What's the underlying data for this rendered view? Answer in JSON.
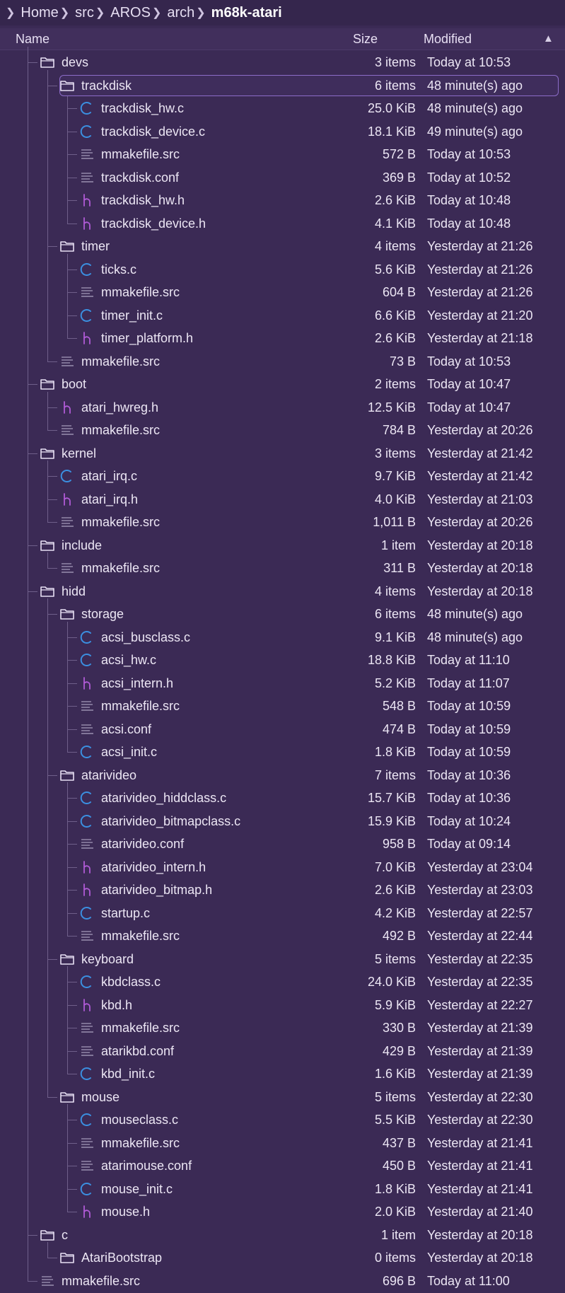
{
  "breadcrumb": {
    "items": [
      "Home",
      "src",
      "AROS",
      "arch",
      "m68k-atari"
    ]
  },
  "columns": {
    "name": "Name",
    "size": "Size",
    "modified": "Modified",
    "sort_indicator": "▲"
  },
  "colors": {
    "background": "#3b2a55",
    "c_icon": "#3b8fe0",
    "h_icon": "#b05ad6",
    "text_icon": "#9a8fb0",
    "folder_icon": "#e8e0f4",
    "selection_border": "#8c6cc8"
  },
  "rows": [
    {
      "name": "devs",
      "type": "folder",
      "depth": 1,
      "size": "3 items",
      "modified": "Today at 10:53"
    },
    {
      "name": "trackdisk",
      "type": "folder",
      "depth": 2,
      "size": "6 items",
      "modified": "48 minute(s) ago",
      "selected": true
    },
    {
      "name": "trackdisk_hw.c",
      "type": "c",
      "depth": 3,
      "size": "25.0 KiB",
      "modified": "48 minute(s) ago"
    },
    {
      "name": "trackdisk_device.c",
      "type": "c",
      "depth": 3,
      "size": "18.1 KiB",
      "modified": "49 minute(s) ago"
    },
    {
      "name": "mmakefile.src",
      "type": "text",
      "depth": 3,
      "size": "572 B",
      "modified": "Today at 10:53"
    },
    {
      "name": "trackdisk.conf",
      "type": "text",
      "depth": 3,
      "size": "369 B",
      "modified": "Today at 10:52"
    },
    {
      "name": "trackdisk_hw.h",
      "type": "h",
      "depth": 3,
      "size": "2.6 KiB",
      "modified": "Today at 10:48"
    },
    {
      "name": "trackdisk_device.h",
      "type": "h",
      "depth": 3,
      "size": "4.1 KiB",
      "modified": "Today at 10:48"
    },
    {
      "name": "timer",
      "type": "folder",
      "depth": 2,
      "size": "4 items",
      "modified": "Yesterday at 21:26"
    },
    {
      "name": "ticks.c",
      "type": "c",
      "depth": 3,
      "size": "5.6 KiB",
      "modified": "Yesterday at 21:26"
    },
    {
      "name": "mmakefile.src",
      "type": "text",
      "depth": 3,
      "size": "604 B",
      "modified": "Yesterday at 21:26"
    },
    {
      "name": "timer_init.c",
      "type": "c",
      "depth": 3,
      "size": "6.6 KiB",
      "modified": "Yesterday at 21:20"
    },
    {
      "name": "timer_platform.h",
      "type": "h",
      "depth": 3,
      "size": "2.6 KiB",
      "modified": "Yesterday at 21:18"
    },
    {
      "name": "mmakefile.src",
      "type": "text",
      "depth": 2,
      "size": "73 B",
      "modified": "Today at 10:53"
    },
    {
      "name": "boot",
      "type": "folder",
      "depth": 1,
      "size": "2 items",
      "modified": "Today at 10:47"
    },
    {
      "name": "atari_hwreg.h",
      "type": "h",
      "depth": 2,
      "size": "12.5 KiB",
      "modified": "Today at 10:47"
    },
    {
      "name": "mmakefile.src",
      "type": "text",
      "depth": 2,
      "size": "784 B",
      "modified": "Yesterday at 20:26"
    },
    {
      "name": "kernel",
      "type": "folder",
      "depth": 1,
      "size": "3 items",
      "modified": "Yesterday at 21:42"
    },
    {
      "name": "atari_irq.c",
      "type": "c",
      "depth": 2,
      "size": "9.7 KiB",
      "modified": "Yesterday at 21:42"
    },
    {
      "name": "atari_irq.h",
      "type": "h",
      "depth": 2,
      "size": "4.0 KiB",
      "modified": "Yesterday at 21:03"
    },
    {
      "name": "mmakefile.src",
      "type": "text",
      "depth": 2,
      "size": "1,011 B",
      "modified": "Yesterday at 20:26"
    },
    {
      "name": "include",
      "type": "folder",
      "depth": 1,
      "size": "1 item",
      "modified": "Yesterday at 20:18"
    },
    {
      "name": "mmakefile.src",
      "type": "text",
      "depth": 2,
      "size": "311 B",
      "modified": "Yesterday at 20:18"
    },
    {
      "name": "hidd",
      "type": "folder",
      "depth": 1,
      "size": "4 items",
      "modified": "Yesterday at 20:18"
    },
    {
      "name": "storage",
      "type": "folder",
      "depth": 2,
      "size": "6 items",
      "modified": "48 minute(s) ago"
    },
    {
      "name": "acsi_busclass.c",
      "type": "c",
      "depth": 3,
      "size": "9.1 KiB",
      "modified": "48 minute(s) ago"
    },
    {
      "name": "acsi_hw.c",
      "type": "c",
      "depth": 3,
      "size": "18.8 KiB",
      "modified": "Today at 11:10"
    },
    {
      "name": "acsi_intern.h",
      "type": "h",
      "depth": 3,
      "size": "5.2 KiB",
      "modified": "Today at 11:07"
    },
    {
      "name": "mmakefile.src",
      "type": "text",
      "depth": 3,
      "size": "548 B",
      "modified": "Today at 10:59"
    },
    {
      "name": "acsi.conf",
      "type": "text",
      "depth": 3,
      "size": "474 B",
      "modified": "Today at 10:59"
    },
    {
      "name": "acsi_init.c",
      "type": "c",
      "depth": 3,
      "size": "1.8 KiB",
      "modified": "Today at 10:59"
    },
    {
      "name": "atarivideo",
      "type": "folder",
      "depth": 2,
      "size": "7 items",
      "modified": "Today at 10:36"
    },
    {
      "name": "atarivideo_hiddclass.c",
      "type": "c",
      "depth": 3,
      "size": "15.7 KiB",
      "modified": "Today at 10:36"
    },
    {
      "name": "atarivideo_bitmapclass.c",
      "type": "c",
      "depth": 3,
      "size": "15.9 KiB",
      "modified": "Today at 10:24"
    },
    {
      "name": "atarivideo.conf",
      "type": "text",
      "depth": 3,
      "size": "958 B",
      "modified": "Today at 09:14"
    },
    {
      "name": "atarivideo_intern.h",
      "type": "h",
      "depth": 3,
      "size": "7.0 KiB",
      "modified": "Yesterday at 23:04"
    },
    {
      "name": "atarivideo_bitmap.h",
      "type": "h",
      "depth": 3,
      "size": "2.6 KiB",
      "modified": "Yesterday at 23:03"
    },
    {
      "name": "startup.c",
      "type": "c",
      "depth": 3,
      "size": "4.2 KiB",
      "modified": "Yesterday at 22:57"
    },
    {
      "name": "mmakefile.src",
      "type": "text",
      "depth": 3,
      "size": "492 B",
      "modified": "Yesterday at 22:44"
    },
    {
      "name": "keyboard",
      "type": "folder",
      "depth": 2,
      "size": "5 items",
      "modified": "Yesterday at 22:35"
    },
    {
      "name": "kbdclass.c",
      "type": "c",
      "depth": 3,
      "size": "24.0 KiB",
      "modified": "Yesterday at 22:35"
    },
    {
      "name": "kbd.h",
      "type": "h",
      "depth": 3,
      "size": "5.9 KiB",
      "modified": "Yesterday at 22:27"
    },
    {
      "name": "mmakefile.src",
      "type": "text",
      "depth": 3,
      "size": "330 B",
      "modified": "Yesterday at 21:39"
    },
    {
      "name": "atarikbd.conf",
      "type": "text",
      "depth": 3,
      "size": "429 B",
      "modified": "Yesterday at 21:39"
    },
    {
      "name": "kbd_init.c",
      "type": "c",
      "depth": 3,
      "size": "1.6 KiB",
      "modified": "Yesterday at 21:39"
    },
    {
      "name": "mouse",
      "type": "folder",
      "depth": 2,
      "size": "5 items",
      "modified": "Yesterday at 22:30"
    },
    {
      "name": "mouseclass.c",
      "type": "c",
      "depth": 3,
      "size": "5.5 KiB",
      "modified": "Yesterday at 22:30"
    },
    {
      "name": "mmakefile.src",
      "type": "text",
      "depth": 3,
      "size": "437 B",
      "modified": "Yesterday at 21:41"
    },
    {
      "name": "atarimouse.conf",
      "type": "text",
      "depth": 3,
      "size": "450 B",
      "modified": "Yesterday at 21:41"
    },
    {
      "name": "mouse_init.c",
      "type": "c",
      "depth": 3,
      "size": "1.8 KiB",
      "modified": "Yesterday at 21:41"
    },
    {
      "name": "mouse.h",
      "type": "h",
      "depth": 3,
      "size": "2.0 KiB",
      "modified": "Yesterday at 21:40"
    },
    {
      "name": "c",
      "type": "folder",
      "depth": 1,
      "size": "1 item",
      "modified": "Yesterday at 20:18"
    },
    {
      "name": "AtariBootstrap",
      "type": "folder",
      "depth": 2,
      "size": "0 items",
      "modified": "Yesterday at 20:18"
    },
    {
      "name": "mmakefile.src",
      "type": "text",
      "depth": 1,
      "size": "696 B",
      "modified": "Today at 11:00"
    }
  ]
}
